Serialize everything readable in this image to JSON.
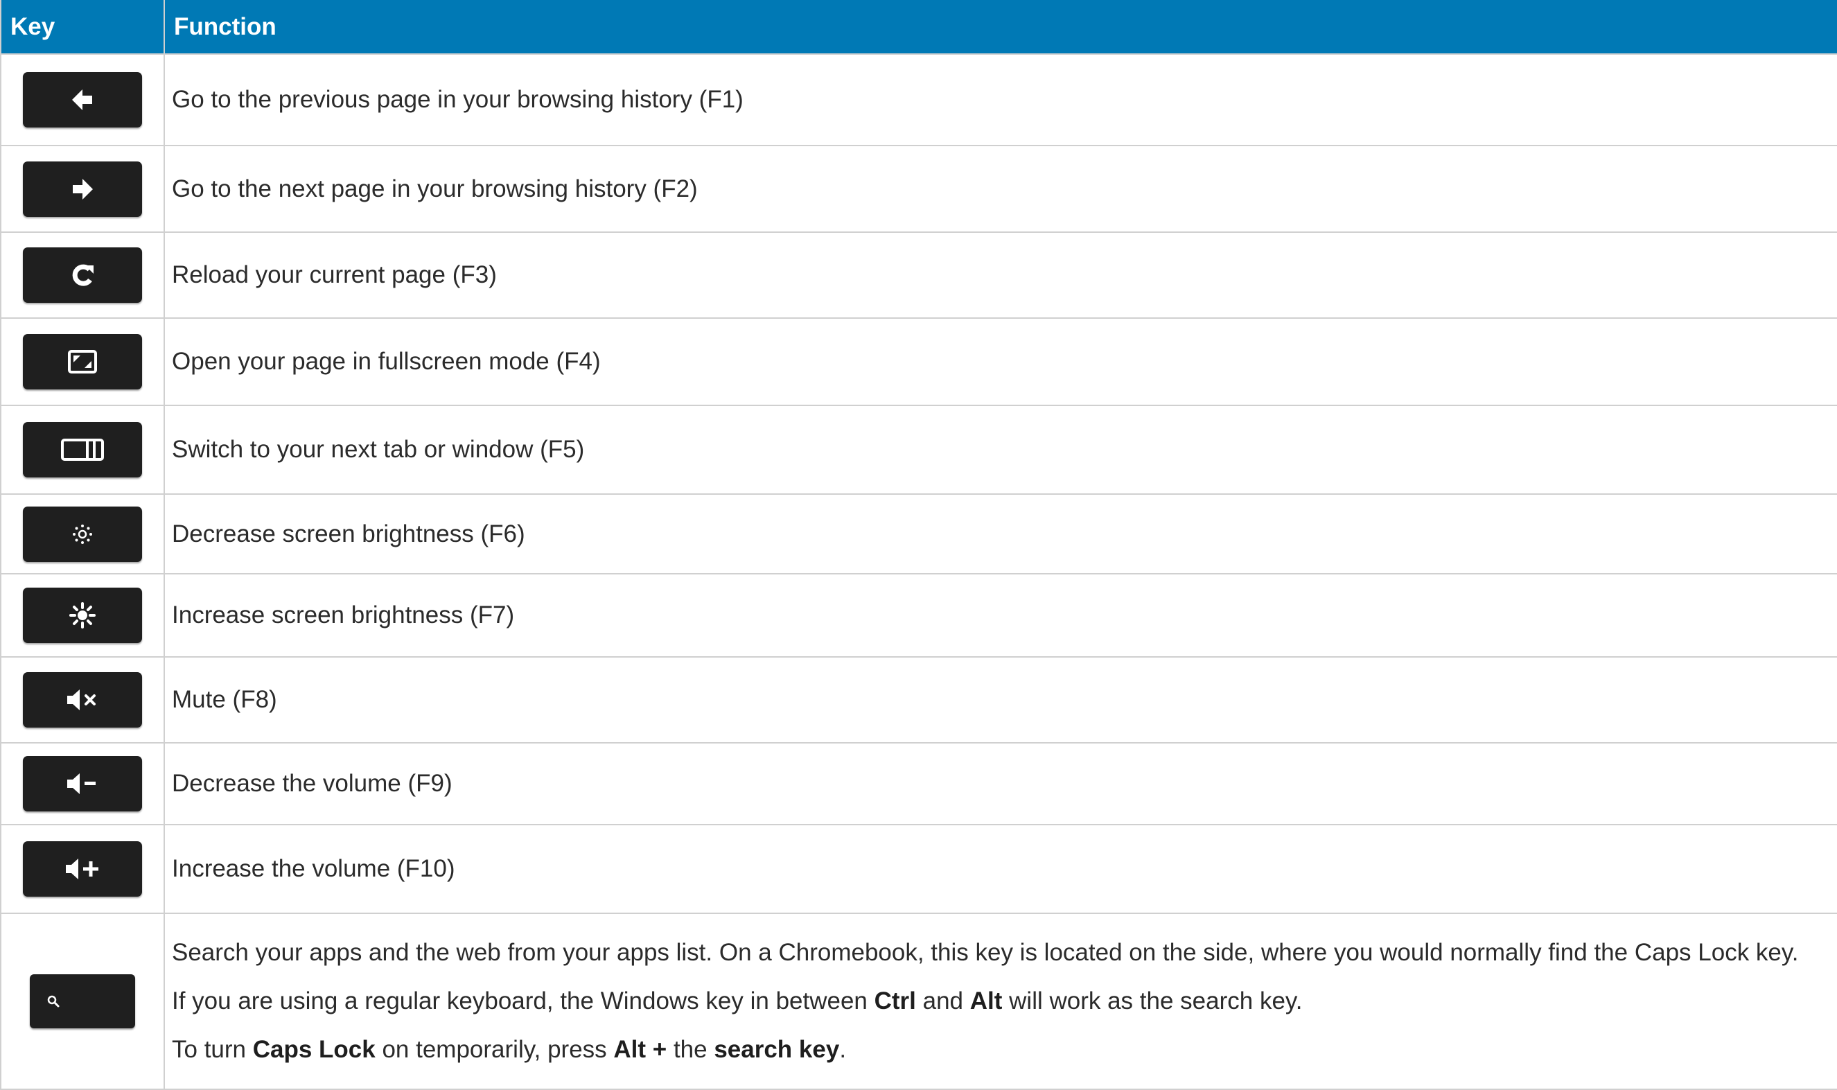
{
  "header": {
    "key_label": "Key",
    "function_label": "Function"
  },
  "colors": {
    "header_bg": "#0079b5",
    "header_text": "#ffffff",
    "keycap": "#1f1f1f",
    "border": "#d0d0d0"
  },
  "rows": [
    {
      "icon": "back-arrow-icon",
      "function": "Go to the previous page in your browsing history (F1)"
    },
    {
      "icon": "forward-arrow-icon",
      "function": "Go to the next page in your browsing history (F2)"
    },
    {
      "icon": "reload-icon",
      "function": "Reload your current page (F3)"
    },
    {
      "icon": "fullscreen-icon",
      "function": "Open your page in fullscreen mode (F4)"
    },
    {
      "icon": "overview-icon",
      "function": "Switch to your next tab or window (F5)"
    },
    {
      "icon": "brightness-down-icon",
      "function": "Decrease screen brightness (F6)"
    },
    {
      "icon": "brightness-up-icon",
      "function": "Increase screen brightness (F7)"
    },
    {
      "icon": "mute-icon",
      "function": "Mute (F8)"
    },
    {
      "icon": "volume-down-icon",
      "function": "Decrease the volume (F9)"
    },
    {
      "icon": "volume-up-icon",
      "function": "Increase the volume (F10)"
    }
  ],
  "search_row": {
    "icon": "search-icon",
    "line1": "Search your apps and the web from your apps list. On a Chromebook, this key is located on the side, where you would normally find the Caps Lock key.",
    "line2": {
      "t1": "If you are using a regular keyboard, the Windows key in between ",
      "b1": "Ctrl",
      "t2": " and ",
      "b2": "Alt",
      "t3": " will work as the search key."
    },
    "line3": {
      "t1": "To turn ",
      "b1": "Caps Lock",
      "t2": " on temporarily, press ",
      "b2": "Alt +",
      "t3": " the ",
      "b3": "search key",
      "t4": "."
    }
  }
}
